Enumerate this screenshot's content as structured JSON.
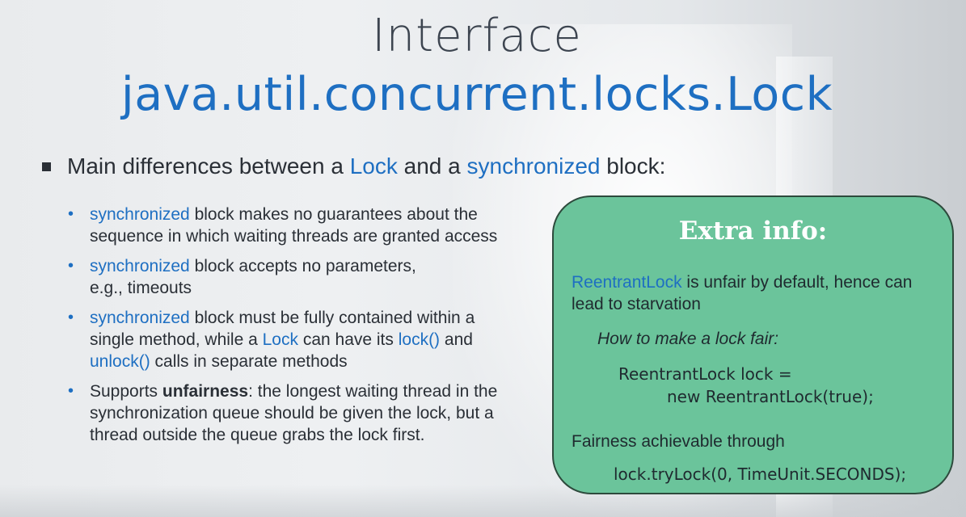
{
  "title": {
    "line1": "Interface",
    "line2": "java.util.concurrent.locks.Lock"
  },
  "main_bullet": {
    "prefix": "Main differences between a ",
    "kw1": "Lock",
    "middle": " and a ",
    "kw2": "synchronized",
    "suffix": " block:"
  },
  "sub_bullets": [
    {
      "kw": "synchronized",
      "text": " block makes no guarantees about the sequence in which waiting threads are granted access"
    },
    {
      "kw": "synchronized",
      "text": " block accepts no parameters, e.g., timeouts"
    },
    {
      "kw": "synchronized",
      "text_a": " block must be fully contained within a single method, while a ",
      "kw2": "Lock",
      "text_b": " can have its ",
      "kw3": "lock()",
      "text_c": " and ",
      "kw4": "unlock()",
      "text_d": " calls in separate methods"
    },
    {
      "text_a": "Supports ",
      "bold": "unfairness",
      "text_b": ": the longest waiting thread in the synchronization queue should be given the lock, but a thread outside the queue grabs the lock first."
    }
  ],
  "extra_box": {
    "title": "Extra info:",
    "intro_kw": "ReentrantLock",
    "intro_text": " is unfair by default, hence can lead to starvation",
    "how_to": "How to make a lock fair:",
    "code_line1": "ReentrantLock lock =",
    "code_line2": "new ReentrantLock(true);",
    "fairness_text": "Fairness achievable through",
    "code_line3": "lock.tryLock(0, TimeUnit.SECONDS);"
  },
  "colors": {
    "accent_blue": "#1e6fc2",
    "box_green": "#6bc49b",
    "text_dark": "#2a2f36"
  }
}
